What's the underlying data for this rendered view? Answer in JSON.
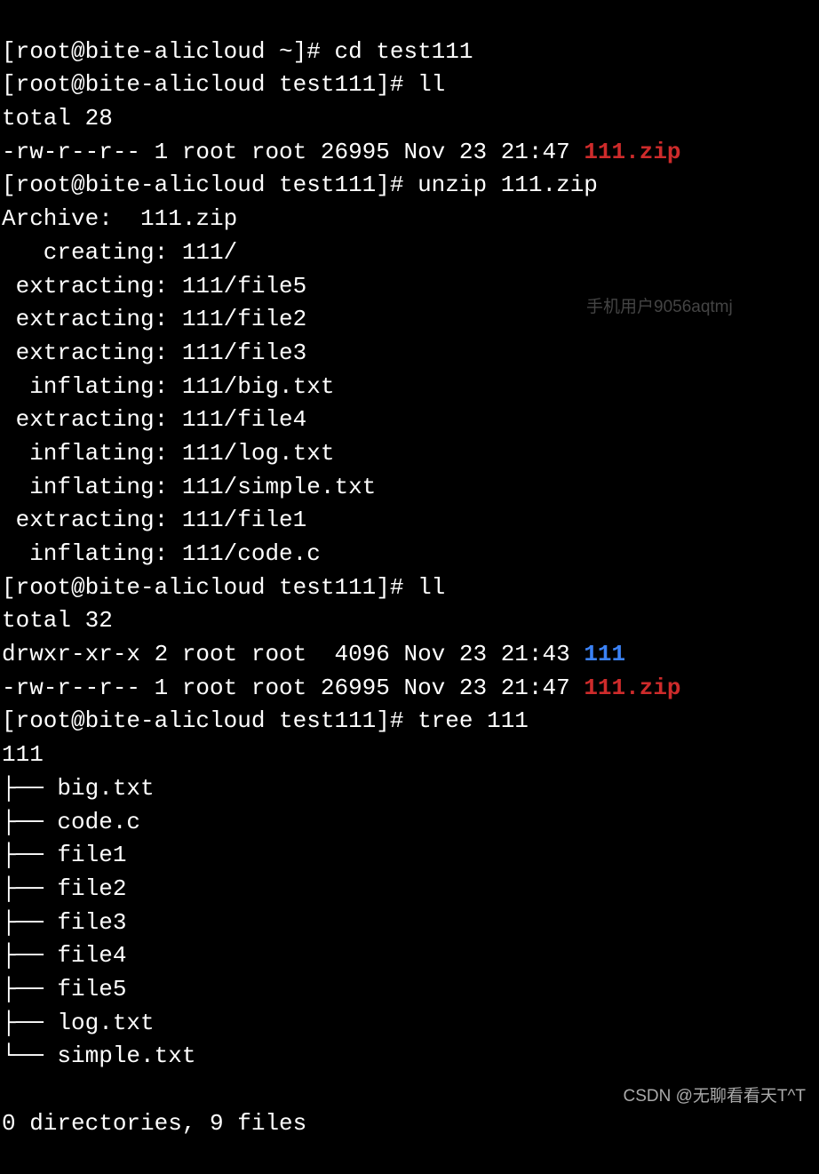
{
  "prompt1": "[root@bite-alicloud ~]# ",
  "cmd1": "cd test111",
  "prompt2": "[root@bite-alicloud test111]# ",
  "cmd2": "ll",
  "total1": "total 28",
  "ll1_perm": "-rw-r--r-- 1 root root 26995 Nov 23 21:47 ",
  "ll1_file": "111.zip",
  "cmd3": "unzip 111.zip",
  "archive": "Archive:  111.zip",
  "unzip1": "   creating: 111/",
  "unzip2": " extracting: 111/file5",
  "unzip3": " extracting: 111/file2",
  "unzip4": " extracting: 111/file3",
  "unzip5": "  inflating: 111/big.txt",
  "unzip6": " extracting: 111/file4",
  "unzip7": "  inflating: 111/log.txt",
  "unzip8": "  inflating: 111/simple.txt",
  "unzip9": " extracting: 111/file1",
  "unzip10": "  inflating: 111/code.c",
  "cmd4": "ll",
  "total2": "total 32",
  "ll2_perm": "drwxr-xr-x 2 root root  4096 Nov 23 21:43 ",
  "ll2_file": "111",
  "ll3_perm": "-rw-r--r-- 1 root root 26995 Nov 23 21:47 ",
  "ll3_file": "111.zip",
  "cmd5": "tree 111",
  "tree_root": "111",
  "tree1": "├── big.txt",
  "tree2": "├── code.c",
  "tree3": "├── file1",
  "tree4": "├── file2",
  "tree5": "├── file3",
  "tree6": "├── file4",
  "tree7": "├── file5",
  "tree8": "├── log.txt",
  "tree9": "└── simple.txt",
  "summary": "0 directories, 9 files",
  "watermark1": "手机用户9056aqtmj",
  "watermark2": "CSDN @无聊看看天T^T"
}
